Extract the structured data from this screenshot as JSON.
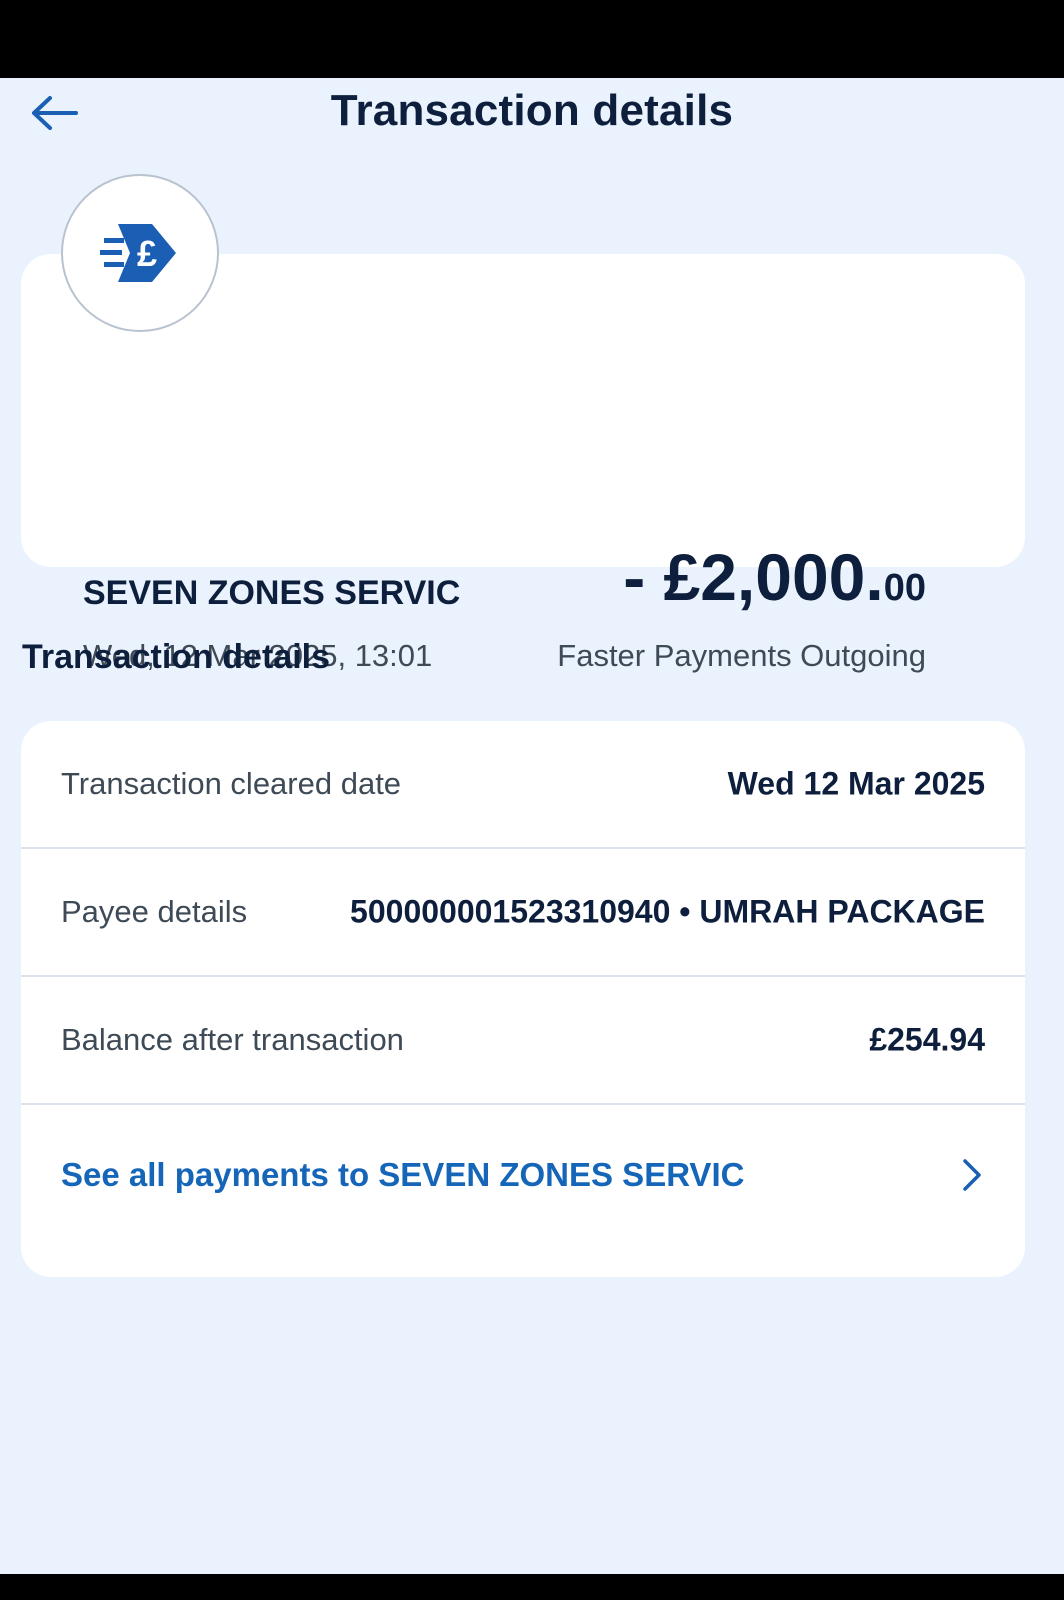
{
  "header": {
    "title": "Transaction details",
    "back_icon": "arrow-left-icon"
  },
  "summary": {
    "logo_icon": "faster-payments-pound-icon",
    "payee_name": "SEVEN ZONES SERVIC",
    "datetime": "Wed, 12 Mar 2025, 13:01",
    "amount_main": "- £2,000.",
    "amount_pence": "00",
    "payment_type": "Faster Payments Outgoing"
  },
  "details": {
    "heading": "Transaction details",
    "rows": [
      {
        "label": "Transaction cleared date",
        "value": "Wed 12 Mar 2025"
      },
      {
        "label": "Payee details",
        "value": "500000001523310940 • UMRAH PACKAGE"
      },
      {
        "label": "Balance after transaction",
        "value": "£254.94"
      }
    ],
    "link": "See all payments to SEVEN ZONES SERVIC"
  },
  "colors": {
    "background": "#eaf3fd",
    "text_primary": "#0d1f3c",
    "link": "#1565b8",
    "icon_blue": "#1a5fb4"
  }
}
